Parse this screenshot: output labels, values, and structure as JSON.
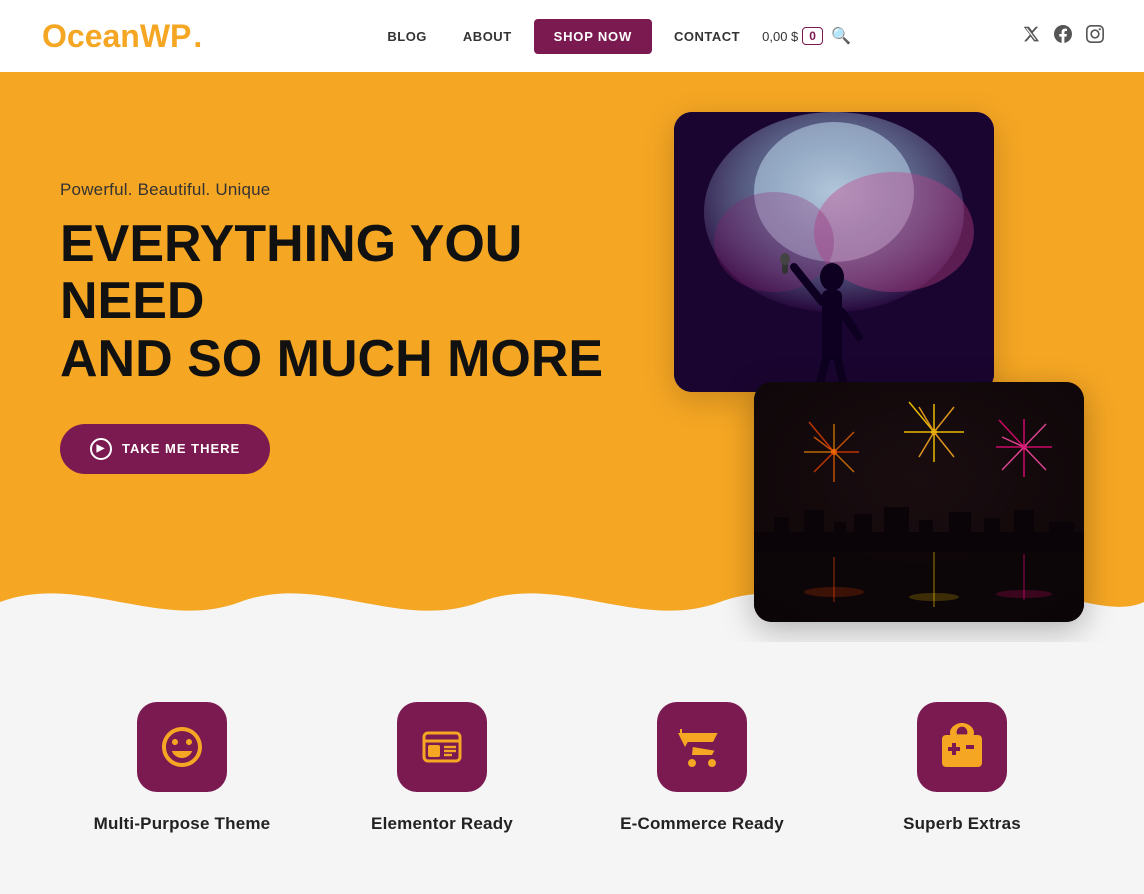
{
  "logo": {
    "text": "OceanWP",
    "dot": "."
  },
  "nav": {
    "links": [
      {
        "id": "blog",
        "label": "BLOG"
      },
      {
        "id": "about",
        "label": "ABOUT"
      },
      {
        "id": "shop-now",
        "label": "SHOP NOW",
        "highlight": true
      },
      {
        "id": "contact",
        "label": "CONTACT"
      }
    ],
    "cart": {
      "price": "0,00 $",
      "count": "0"
    },
    "social": [
      {
        "id": "twitter",
        "symbol": "𝕏"
      },
      {
        "id": "facebook",
        "symbol": "f"
      },
      {
        "id": "instagram",
        "symbol": "◻"
      }
    ]
  },
  "hero": {
    "subtitle": "Powerful. Beautiful. Unique",
    "title_line1": "EVERYTHING YOU NEED",
    "title_line2": "AND SO MUCH MORE",
    "cta_label": "TAKE ME THERE"
  },
  "features": [
    {
      "id": "multi-purpose",
      "label": "Multi-Purpose Theme",
      "icon": "😊"
    },
    {
      "id": "elementor",
      "label": "Elementor Ready",
      "icon": "🪪"
    },
    {
      "id": "ecommerce",
      "label": "E-Commerce Ready",
      "icon": "🛒"
    },
    {
      "id": "extras",
      "label": "Superb Extras",
      "icon": "🎁"
    }
  ],
  "colors": {
    "yellow": "#f5a623",
    "purple": "#7b1a50",
    "dark": "#111"
  }
}
